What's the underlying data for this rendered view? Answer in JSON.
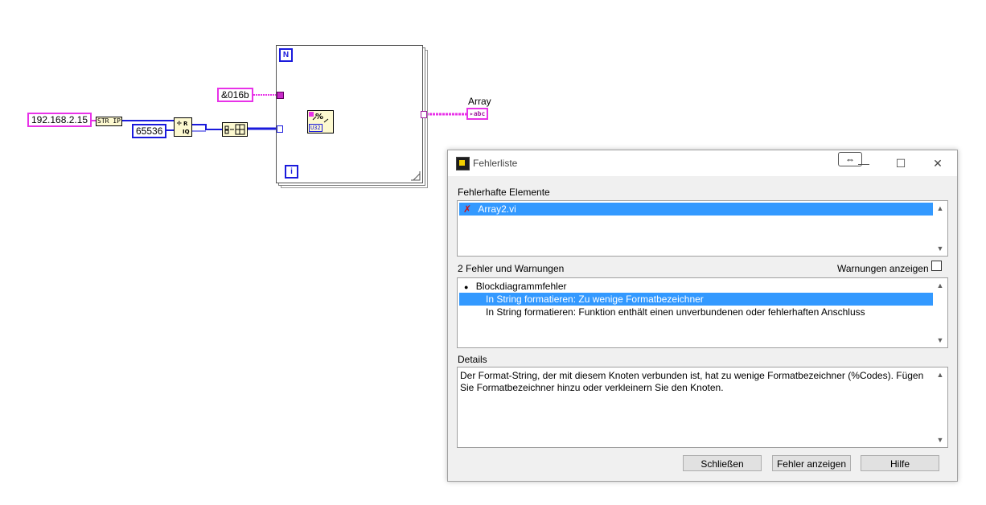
{
  "diagram": {
    "ip_constant": "192.168.2.15",
    "str_ip_node": "STR IP",
    "port_constant": "65536",
    "format_constant": "&016b",
    "loop_count_label": "N",
    "loop_index_label": "i",
    "array_label": "Array",
    "indicator_text": "abc",
    "format_node_type": "U32"
  },
  "dialog": {
    "title": "Fehlerliste",
    "resize_glyph": "⇔",
    "minimize_glyph": "—",
    "maximize_glyph": "☐",
    "close_glyph": "✕",
    "faulty_elements_label": "Fehlerhafte Elemente",
    "faulty_elements": [
      {
        "label": "Array2.vi",
        "icon": "error-x-icon",
        "selected": true
      }
    ],
    "errors_label": "2 Fehler und Warnungen",
    "show_warnings_label": "Warnungen anzeigen",
    "errors": [
      {
        "label": "Blockdiagrammfehler",
        "bullet": "●",
        "indent": 0,
        "selected": false
      },
      {
        "label": "In String formatieren: Zu wenige Formatbezeichner",
        "indent": 1,
        "selected": true
      },
      {
        "label": "In String formatieren: Funktion enthält einen unverbundenen oder fehlerhaften Anschluss",
        "indent": 1,
        "selected": false
      }
    ],
    "details_label": "Details",
    "details_text": "Der Format-String, der mit diesem Knoten verbunden ist, hat zu wenige Formatbezeichner (%Codes).  Fügen Sie Formatbezeichner hinzu oder verkleinern Sie den Knoten.",
    "buttons": {
      "close": "Schließen",
      "show_error": "Fehler anzeigen",
      "help": "Hilfe"
    }
  },
  "colors": {
    "string_wire": "#e832e8",
    "numeric_wire": "#1a1adc",
    "selection": "#3399ff"
  }
}
